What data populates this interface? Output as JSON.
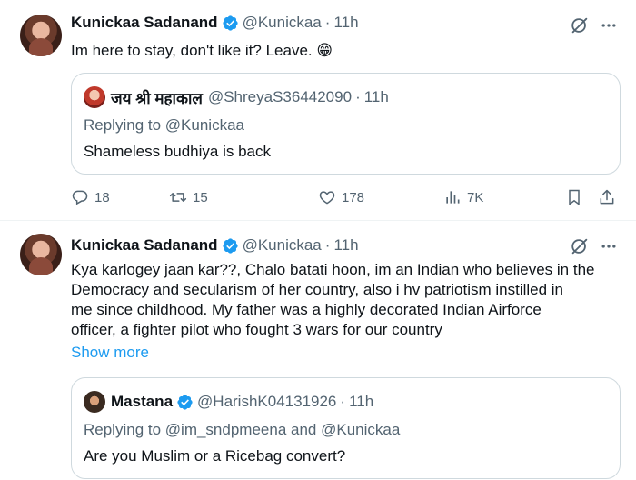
{
  "tweets": [
    {
      "author": {
        "name": "Kunickaa Sadanand",
        "handle": "@Kunickaa",
        "time": "11h"
      },
      "text": "Im here to stay, don't like it? Leave. 😁",
      "quote": {
        "author": {
          "name": "जय श्री महाकाल",
          "handle": "@ShreyaS36442090",
          "time": "11h"
        },
        "replying_prefix": "Replying to ",
        "replying_to": "@Kunickaa",
        "text": "Shameless budhiya is back"
      },
      "actions": {
        "replies": "18",
        "reposts": "15",
        "likes": "178",
        "views": "7K"
      }
    },
    {
      "author": {
        "name": "Kunickaa Sadanand",
        "handle": "@Kunickaa",
        "time": "11h"
      },
      "text_lines": [
        "Kya karlogey jaan kar??, Chalo batati hoon, im an Indian who believes in the",
        "Democracy and secularism of her country, also i hv patriotism instilled in",
        "me since childhood. My father was a highly decorated Indian Airforce",
        "officer, a fighter pilot who fought 3 wars for our country"
      ],
      "show_more": "Show more",
      "quote": {
        "author": {
          "name": "Mastana",
          "handle": "@HarishK04131926",
          "time": "11h"
        },
        "replying_prefix": "Replying to ",
        "replying_to_1": "@im_sndpmeena",
        "replying_and": " and ",
        "replying_to_2": "@Kunickaa",
        "text": "Are you Muslim or a Ricebag convert?"
      }
    }
  ],
  "colors": {
    "accent": "#1d9bf0",
    "muted": "#536471",
    "text": "#0f1419",
    "border": "#cfd9de"
  },
  "icons": [
    "verified-badge-icon",
    "grok-icon",
    "more-icon",
    "reply-icon",
    "repost-icon",
    "like-icon",
    "views-icon",
    "bookmark-icon",
    "share-icon"
  ]
}
